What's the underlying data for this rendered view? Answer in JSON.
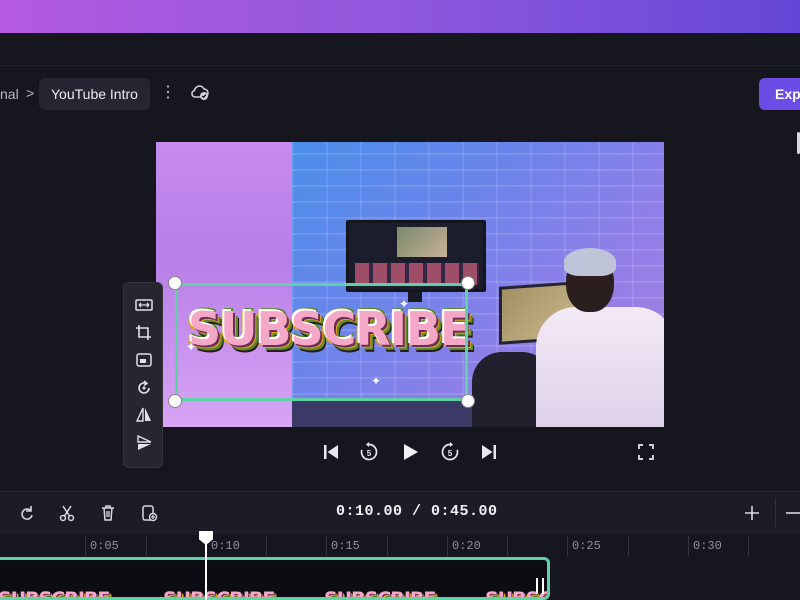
{
  "header": {
    "breadcrumb_parent": "nal",
    "breadcrumb_separator": ">",
    "project_title": "YouTube Intro",
    "more_icon": "kebab-icon",
    "cloud_icon": "cloud-sync-icon",
    "export_label": "Expo"
  },
  "preview": {
    "overlay_text": "SUBSCRIBE",
    "toolbox": [
      {
        "name": "fit-icon"
      },
      {
        "name": "crop-icon"
      },
      {
        "name": "picture-in-picture-icon"
      },
      {
        "name": "rotate-icon"
      },
      {
        "name": "flip-horizontal-icon"
      },
      {
        "name": "flip-vertical-icon"
      }
    ]
  },
  "playback": {
    "skip_back_icon": "skip-to-start-icon",
    "rewind_label": "5",
    "play_icon": "play-icon",
    "forward_label": "5",
    "skip_forward_icon": "skip-to-end-icon",
    "fullscreen_icon": "fullscreen-icon"
  },
  "timeline": {
    "timecode": "0:10.00 / 0:45.00",
    "ruler_labels": [
      "0:05",
      "0:10",
      "0:15",
      "0:20",
      "0:25",
      "0:30"
    ],
    "clip_thumb_text": "SUBSCRIBE",
    "playhead_time": "0:10.00"
  },
  "colors": {
    "accent": "#6b4de6",
    "selection": "#5fd1a4",
    "banner_start": "#b45ae0",
    "banner_end": "#6447d6"
  }
}
